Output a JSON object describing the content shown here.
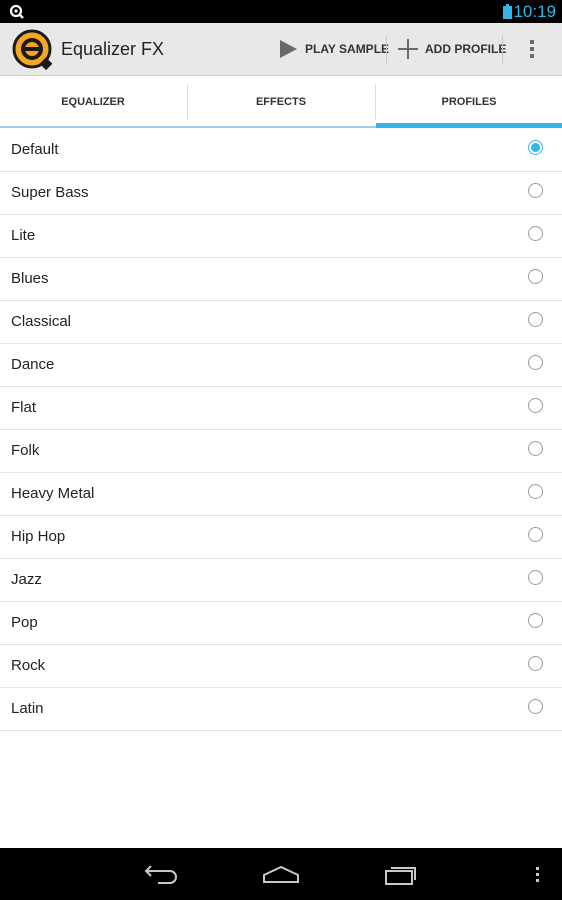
{
  "status_bar": {
    "time": "10:19",
    "left_icon": "equalizer-notification-icon",
    "battery_icon": "battery-icon",
    "accent_color": "#33b5e5"
  },
  "action_bar": {
    "app_title": "Equalizer FX",
    "logo_icon": "equalizer-fx-logo",
    "logo_color": "#f5a623",
    "play_sample_label": "PLAY SAMPLE",
    "play_icon": "play-icon",
    "add_profile_label": "ADD PROFILE",
    "add_icon": "plus-icon",
    "overflow_icon": "overflow-menu-icon"
  },
  "tabs": [
    {
      "label": "EQUALIZER",
      "selected": false
    },
    {
      "label": "EFFECTS",
      "selected": false
    },
    {
      "label": "PROFILES",
      "selected": true
    }
  ],
  "profiles": [
    {
      "name": "Default",
      "selected": true
    },
    {
      "name": "Super Bass",
      "selected": false
    },
    {
      "name": "Lite",
      "selected": false
    },
    {
      "name": "Blues",
      "selected": false
    },
    {
      "name": "Classical",
      "selected": false
    },
    {
      "name": "Dance",
      "selected": false
    },
    {
      "name": "Flat",
      "selected": false
    },
    {
      "name": "Folk",
      "selected": false
    },
    {
      "name": "Heavy Metal",
      "selected": false
    },
    {
      "name": "Hip Hop",
      "selected": false
    },
    {
      "name": "Jazz",
      "selected": false
    },
    {
      "name": "Pop",
      "selected": false
    },
    {
      "name": "Rock",
      "selected": false
    },
    {
      "name": "Latin",
      "selected": false
    }
  ],
  "nav_bar": {
    "back_icon": "back-icon",
    "home_icon": "home-icon",
    "recents_icon": "recent-apps-icon",
    "menu_icon": "menu-icon"
  }
}
